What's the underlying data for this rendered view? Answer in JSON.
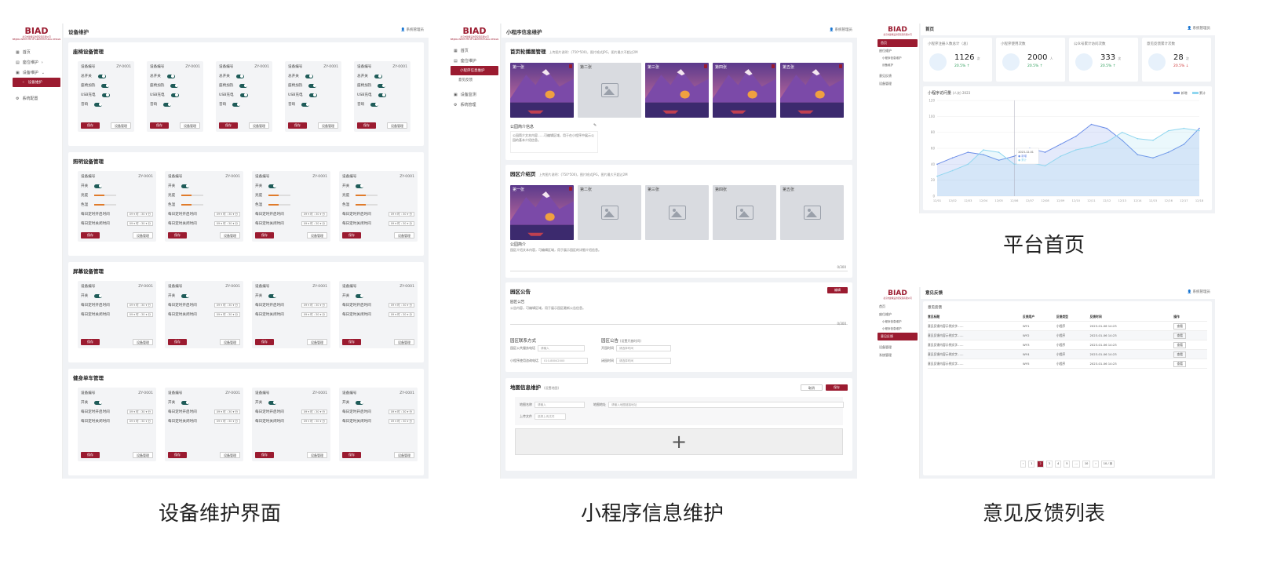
{
  "brand": {
    "logo": "BIAD",
    "logo_sub": "北京市建筑设计研究院有限公司",
    "logo_sub_en": "BEIJING INSTITUTE OF ARCHITECTURAL DESIGN",
    "accent": "#9b1b30",
    "toggle_color": "#1f5c59"
  },
  "captions": {
    "left": "设备维护界面",
    "middle": "小程序信息维护",
    "right_top": "平台首页",
    "right_bottom": "意见反馈列表"
  },
  "left": {
    "title": "设备维护",
    "user": "系统管理员",
    "nav": [
      "首页",
      "座位维护",
      "设备维护",
      "设备维护",
      "系统配置"
    ],
    "sections": [
      {
        "title": "座椅设备管理",
        "cards": 5,
        "rows": [
          [
            "设备编号",
            "ZY-0001"
          ],
          [
            "总开关",
            ""
          ],
          [
            "座椅加热",
            ""
          ],
          [
            "USB充电",
            ""
          ],
          [
            "音响",
            ""
          ]
        ],
        "btn1": "保存",
        "btn2": "设备管理"
      },
      {
        "title": "照明设备管理",
        "cards": 4,
        "rows": [
          [
            "设备编号",
            "ZY-0001"
          ],
          [
            "开关",
            ""
          ],
          [
            "亮度",
            ""
          ],
          [
            "色温",
            ""
          ],
          [
            "每日定时开启时间",
            "09 ▾ 时 : 30 ▾ 分"
          ],
          [
            "每日定时关闭时间",
            "09 ▾ 时 : 30 ▾ 分"
          ]
        ],
        "btn1": "保存",
        "btn2": "设备管理"
      },
      {
        "title": "屏幕设备管理",
        "cards": 4,
        "rows": [
          [
            "设备编号",
            "ZY-0001"
          ],
          [
            "开关",
            ""
          ],
          [
            "每日定时开启时间",
            "09 ▾ 时 : 30 ▾ 分"
          ],
          [
            "每日定时关闭时间",
            "09 ▾ 时 : 30 ▾ 分"
          ]
        ],
        "btn1": "保存",
        "btn2": "设备管理"
      },
      {
        "title": "健身单车管理",
        "cards": 4,
        "rows": [
          [
            "设备编号",
            "ZY-0001"
          ],
          [
            "开关",
            ""
          ],
          [
            "每日定时开启时间",
            "09 ▾ 时 : 30 ▾ 分"
          ],
          [
            "每日定时关闭时间",
            "09 ▾ 时 : 30 ▾ 分"
          ]
        ],
        "btn1": "保存",
        "btn2": "设备管理"
      }
    ]
  },
  "middle": {
    "title": "小程序信息维护",
    "user": "系统管理员",
    "nav": [
      "首页",
      "座位维护",
      "小程序信息维护",
      "意见反馈",
      "设备监测",
      "系统管理"
    ],
    "carousel": {
      "title": "首页轮播图管理",
      "hint": "上传图片说明：(750*500)，图片格式JPG，图片最大不超过2M",
      "slides": [
        "第一张",
        "第二张",
        "第三张",
        "第四张",
        "第五张"
      ],
      "filled": [
        true,
        false,
        true,
        true,
        true
      ]
    },
    "intro_title": "公园简介信息",
    "intro_text": "公园简介文本内容……可编辑区域，用于在小程序中展示公园的基本介绍信息。",
    "zone": {
      "title": "园区介绍页",
      "hint": "上传图片说明：(750*500)，图片格式JPG，图片最大不超过2M",
      "slides": [
        "第一张",
        "第二张",
        "第三张",
        "第四张",
        "第五张"
      ],
      "filled": [
        true,
        false,
        false,
        false,
        false
      ]
    },
    "zone_intro_label": "公园简介",
    "zone_text": "园区介绍文本内容，可编辑区域，用于展示园区的详细介绍信息。",
    "zone_count": "0/300",
    "notice": {
      "title": "园区公告",
      "btn": "编辑",
      "label": "园区公告",
      "text": "公告内容，可编辑区域，用于展示园区最新公告信息。",
      "count": "0/300"
    },
    "contact": {
      "title": "园区联系方式",
      "f1": "园区公共服务电话",
      "v1": "请输入",
      "f2": "小程序使用咨询电话",
      "v2": "010-88042000"
    },
    "hours": {
      "title": "园区公告",
      "hint": "(设置开放时间)",
      "f1": "开园时间",
      "v1": "请选择时间",
      "f2": "闭园时间",
      "v2": "请选择时间"
    },
    "map": {
      "title": "地图信息维护",
      "hint": "(设置地图)",
      "btn_cancel": "取消",
      "btn_save": "保存",
      "f1": "地图名称",
      "v1": "请输入",
      "f2": "地图地址",
      "v2": "请输入地图链接地址",
      "f3": "上传文件",
      "v3": "选择上传文件",
      "add": "+"
    }
  },
  "right_top": {
    "title": "首页",
    "user": "系统管理员",
    "nav": [
      "首页",
      "座位维护",
      "小程序信息维护",
      "设备维护",
      "意见反馈",
      "设备管理",
      "系统管理"
    ],
    "stats": [
      {
        "title": "小程序注册人数总计（总）",
        "value": "1126",
        "unit": "次",
        "pct": "20.5% ↑",
        "color": "#2e9e5b"
      },
      {
        "title": "小程序使用次数",
        "value": "2000",
        "unit": "人",
        "pct": "20.5% ↑",
        "color": "#2e9e5b"
      },
      {
        "title": "公众号累计访问次数",
        "value": "333",
        "unit": "次",
        "pct": "20.5% ↑",
        "color": "#2e9e5b"
      },
      {
        "title": "意见反馈累计次数",
        "value": "28",
        "unit": "次",
        "pct": "20.5% ↓",
        "color": "#d03a3a"
      }
    ],
    "chart_title": "小程序访问量",
    "chart_sub": "(人次) 2023",
    "legend": [
      "新增",
      "累计"
    ]
  },
  "chart_data": {
    "type": "area",
    "title": "小程序访问量",
    "x": [
      "12/01",
      "12/02",
      "12/03",
      "12/04",
      "12/05",
      "12/06",
      "12/07",
      "12/08",
      "12/09",
      "12/10",
      "12/11",
      "12/12",
      "12/13",
      "12/14",
      "12/15",
      "12/16",
      "12/17",
      "12/18"
    ],
    "ylim": [
      0,
      120
    ],
    "yticks": [
      0,
      20,
      40,
      60,
      80,
      100,
      120
    ],
    "series": [
      {
        "name": "新增",
        "color": "#6b8de8",
        "values": [
          40,
          48,
          55,
          52,
          45,
          50,
          60,
          55,
          65,
          75,
          90,
          85,
          70,
          52,
          48,
          55,
          65,
          85
        ]
      },
      {
        "name": "累计",
        "color": "#8fd6ef",
        "values": [
          25,
          32,
          40,
          58,
          55,
          40,
          42,
          38,
          50,
          58,
          62,
          68,
          80,
          72,
          70,
          82,
          85,
          82
        ]
      }
    ],
    "tooltip": "2023-12-01"
  },
  "right_bottom": {
    "title": "意见反馈",
    "user": "系统管理员",
    "nav": [
      "首页",
      "座位维护",
      "小程序信息维护",
      "小程序信息维护",
      "意见反馈",
      "设备管理",
      "系统管理"
    ],
    "list_title": "意见反馈",
    "headers": [
      "意见标题",
      "反馈用户",
      "反馈类型",
      "反馈时间",
      "操作"
    ],
    "rows": [
      [
        "意见反馈内容示例文字……",
        "WY1",
        "小程序",
        "2023-01-06 14:23",
        "查看"
      ],
      [
        "意见反馈内容示例文字……",
        "WY2",
        "小程序",
        "2023-01-06 14:23",
        "查看"
      ],
      [
        "意见反馈内容示例文字……",
        "WY3",
        "小程序",
        "2023-01-06 14:23",
        "查看"
      ],
      [
        "意见反馈内容示例文字……",
        "WY4",
        "小程序",
        "2023-01-06 14:23",
        "查看"
      ],
      [
        "意见反馈内容示例文字……",
        "WY5",
        "小程序",
        "2023-01-06 14:23",
        "查看"
      ]
    ],
    "pager": [
      "‹",
      "1",
      "2",
      "3",
      "4",
      "5",
      "…",
      "10",
      "›",
      "10 / 页"
    ]
  }
}
